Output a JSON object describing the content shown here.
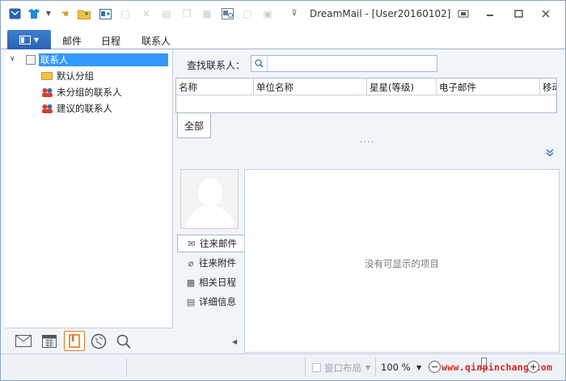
{
  "titlebar": {
    "title": "DreamMail - [User20160102]",
    "quick_access": [
      "app-mail-icon",
      "shirt-icon",
      "dropdown-icon",
      "hand-icon",
      "folder-icon",
      "add-contact-icon",
      "doc-icon",
      "delete-icon",
      "save-icon",
      "copy-icon",
      "paste-icon",
      "contact-card-icon",
      "blank-doc-icon",
      "clipboard-icon",
      "customize-icon"
    ]
  },
  "tabs": {
    "items": [
      {
        "label": "邮件"
      },
      {
        "label": "日程"
      },
      {
        "label": "联系人"
      }
    ]
  },
  "tree": {
    "root": "联系人",
    "children": [
      "默认分组",
      "未分组的联系人",
      "建议的联系人"
    ]
  },
  "search": {
    "label": "查找联系人：",
    "value": "",
    "placeholder": ""
  },
  "grid": {
    "columns": [
      "名称",
      "单位名称",
      "星星(等级)",
      "电子邮件",
      "移动"
    ]
  },
  "filter_tab": "全部",
  "dots": "....",
  "detail_tabs": [
    {
      "label": "往来邮件",
      "icon": "mail-icon",
      "active": true
    },
    {
      "label": "往来附件",
      "icon": "paperclip-icon",
      "active": false
    },
    {
      "label": "相关日程",
      "icon": "calendar-icon",
      "active": false
    },
    {
      "label": "详细信息",
      "icon": "card-icon",
      "active": false
    }
  ],
  "detail": {
    "empty_message": "没有可显示的项目"
  },
  "statusbar": {
    "layout_label": "窗口布局",
    "zoom": "100 %",
    "watermark": "www.qinpinchang.com"
  },
  "colors": {
    "accent": "#2a62b0",
    "selection": "#3399ff",
    "watermark": "#e0241b"
  }
}
